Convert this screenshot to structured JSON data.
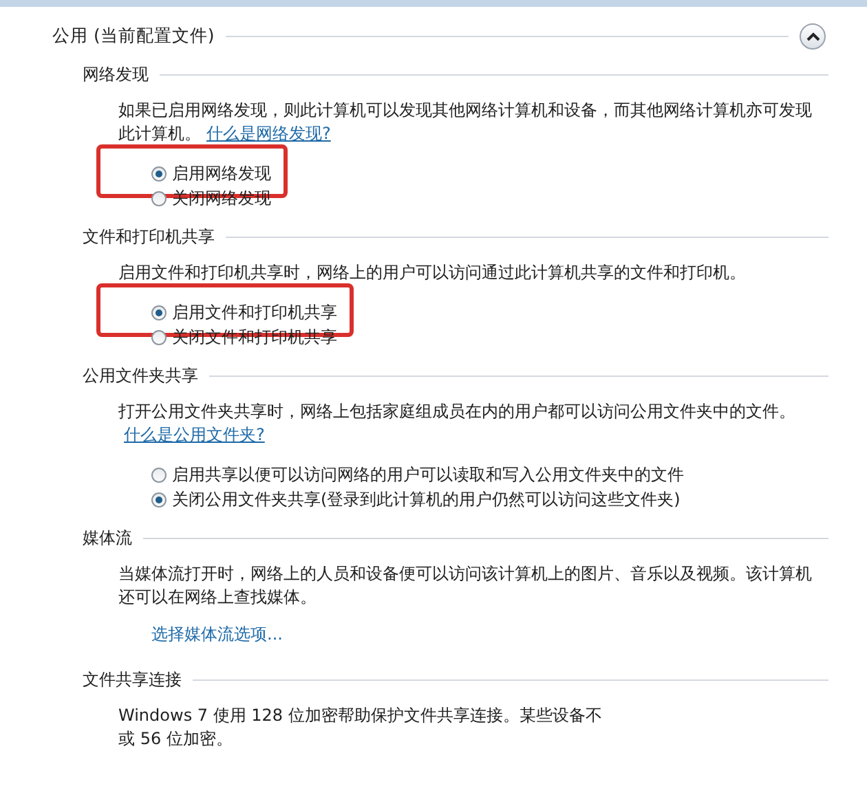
{
  "profile": {
    "title": "公用 (当前配置文件)",
    "expanded": true
  },
  "sections": [
    {
      "heading": "网络发现",
      "description": "如果已启用网络发现，则此计算机可以发现其他网络计算机和设备，而其他网络计算机亦可发现此计算机。",
      "link": "什么是网络发现?",
      "options": [
        {
          "label": "启用网络发现",
          "selected": true,
          "highlighted": true
        },
        {
          "label": "关闭网络发现",
          "selected": false,
          "highlighted": false
        }
      ]
    },
    {
      "heading": "文件和打印机共享",
      "description": "启用文件和打印机共享时，网络上的用户可以访问通过此计算机共享的文件和打印机。",
      "options": [
        {
          "label": "启用文件和打印机共享",
          "selected": true,
          "highlighted": true
        },
        {
          "label": "关闭文件和打印机共享",
          "selected": false,
          "highlighted": false
        }
      ]
    },
    {
      "heading": "公用文件夹共享",
      "description": "打开公用文件夹共享时，网络上包括家庭组成员在内的用户都可以访问公用文件夹中的文件。",
      "link": "什么是公用文件夹?",
      "options": [
        {
          "label": "启用共享以便可以访问网络的用户可以读取和写入公用文件夹中的文件",
          "selected": false,
          "highlighted": false
        },
        {
          "label": "关闭公用文件夹共享(登录到此计算机的用户仍然可以访问这些文件夹)",
          "selected": true,
          "highlighted": false
        }
      ]
    },
    {
      "heading": "媒体流",
      "description": "当媒体流打开时，网络上的人员和设备便可以访问该计算机上的图片、音乐以及视频。该计算机还可以在网络上查找媒体。",
      "action": "选择媒体流选项..."
    },
    {
      "heading": "文件共享连接",
      "description_lines": [
        "Windows 7 使用 128 位加密帮助保护文件共享连接。某些设备不",
        "或 56 位加密。"
      ]
    }
  ]
}
